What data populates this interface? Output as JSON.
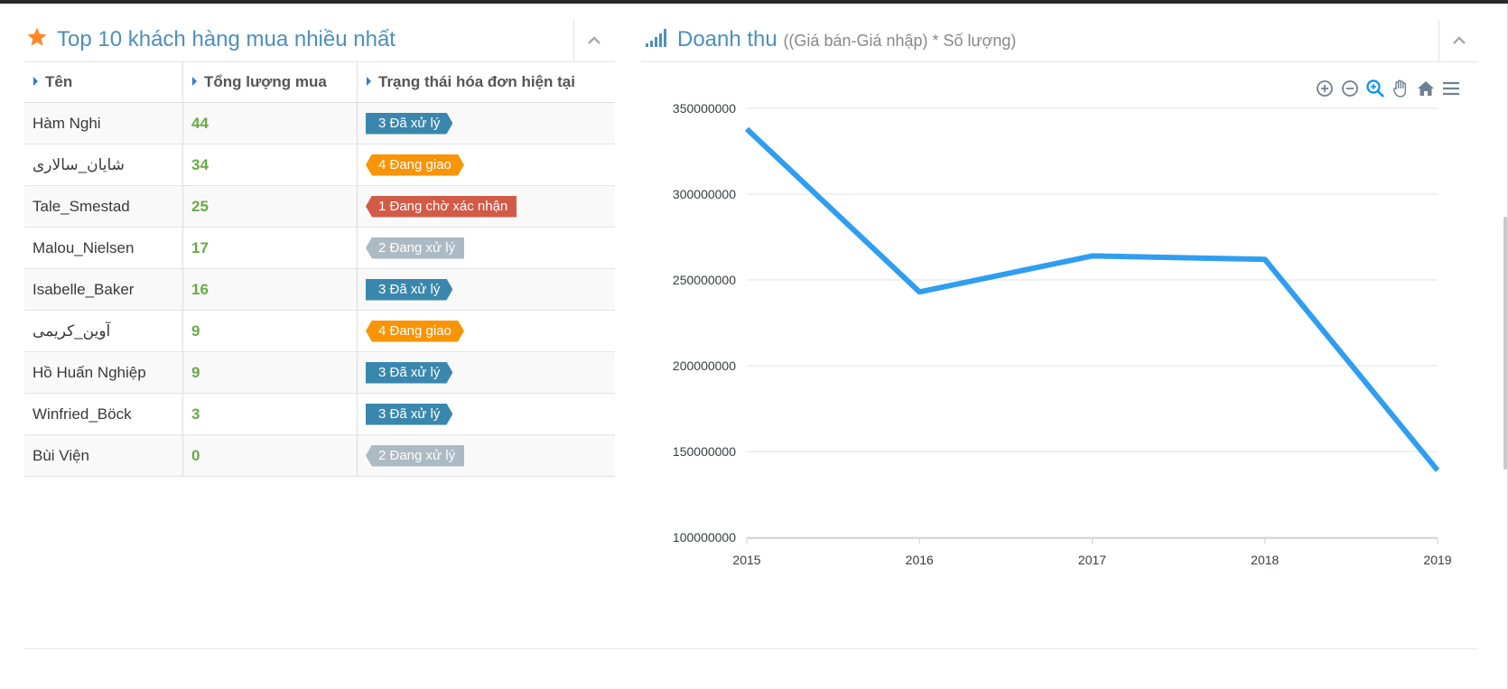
{
  "colors": {
    "header_blue": "#4c8fbd",
    "qty_green": "#69aa46",
    "badge_blue": "#3a87ad",
    "badge_orange": "#f89406",
    "badge_red": "#d15b47",
    "badge_grey": "#abbac3",
    "line": "#2f9ef0",
    "star": "#ff892a"
  },
  "left_widget": {
    "title": "Top 10 khách hàng mua nhiều nhất",
    "icon": "star-icon",
    "columns": [
      "Tên",
      "Tổng lượng mua",
      "Trạng thái hóa đơn hiện tại"
    ],
    "rows": [
      {
        "name": "Hàm Nghi",
        "qty": "44",
        "status": "3 Đã xử lý",
        "status_color": "#3a87ad",
        "shape": "arrow-right"
      },
      {
        "name": "شایان_سالاری",
        "qty": "34",
        "status": "4 Đang giao",
        "status_color": "#f89406",
        "shape": "arrow-both"
      },
      {
        "name": "Tale_Smestad",
        "qty": "25",
        "status": "1 Đang chờ xác nhận",
        "status_color": "#d15b47",
        "shape": "arrow-left"
      },
      {
        "name": "Malou_Nielsen",
        "qty": "17",
        "status": "2 Đang xử lý",
        "status_color": "#abbac3",
        "shape": "arrow-left"
      },
      {
        "name": "Isabelle_Baker",
        "qty": "16",
        "status": "3 Đã xử lý",
        "status_color": "#3a87ad",
        "shape": "arrow-right"
      },
      {
        "name": "آوین_کریمی",
        "qty": "9",
        "status": "4 Đang giao",
        "status_color": "#f89406",
        "shape": "arrow-both"
      },
      {
        "name": "Hồ Huấn Nghiệp",
        "qty": "9",
        "status": "3 Đã xử lý",
        "status_color": "#3a87ad",
        "shape": "arrow-right"
      },
      {
        "name": "Winfried_Böck",
        "qty": "3",
        "status": "3 Đã xử lý",
        "status_color": "#3a87ad",
        "shape": "arrow-right"
      },
      {
        "name": "Bùi Viện",
        "qty": "0",
        "status": "2 Đang xử lý",
        "status_color": "#abbac3",
        "shape": "arrow-left"
      }
    ]
  },
  "right_widget": {
    "title": "Doanh thu",
    "subtitle": "((Giá bán-Giá nhập) * Số lượng)",
    "icon": "signal-icon",
    "toolbar": [
      "zoom-in-icon",
      "zoom-out-icon",
      "zoom-select-icon",
      "pan-icon",
      "home-icon",
      "menu-icon"
    ]
  },
  "chart_data": {
    "type": "line",
    "title": "",
    "xlabel": "",
    "ylabel": "",
    "x": [
      "2015",
      "2016",
      "2017",
      "2018",
      "2019"
    ],
    "series": [
      {
        "values": [
          338000000,
          243000000,
          264000000,
          262000000,
          139000000
        ]
      }
    ],
    "ylim": [
      100000000,
      350000000
    ],
    "yticks": [
      "350000000",
      "300000000",
      "250000000",
      "200000000",
      "150000000",
      "100000000"
    ],
    "grid": true,
    "legend": "none"
  }
}
